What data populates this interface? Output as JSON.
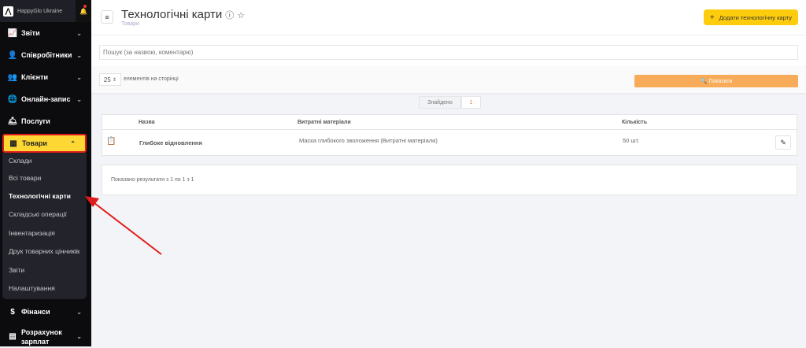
{
  "sidebar": {
    "brand": "HappyGlo Ukraine",
    "items": [
      {
        "label": "Звіти",
        "icon": "chart-icon"
      },
      {
        "label": "Співробітники",
        "icon": "user-icon"
      },
      {
        "label": "Клієнти",
        "icon": "users-icon"
      },
      {
        "label": "Онлайн-запис",
        "icon": "globe-icon"
      },
      {
        "label": "Послуги",
        "icon": "service-bell-icon"
      },
      {
        "label": "Товари",
        "icon": "boxes-icon"
      },
      {
        "label": "Фінанси",
        "icon": "dollar-icon"
      },
      {
        "label": "Розрахунок",
        "label2": "зарплат",
        "icon": "payroll-icon"
      }
    ],
    "submenu": [
      "Склади",
      "Всі товари",
      "Технологічні карти",
      "Складські операції",
      "Інвентаризація",
      "Друк товарних цінників",
      "Звіти",
      "Налаштування"
    ]
  },
  "header": {
    "title": "Технологічні карти",
    "breadcrumb": "Товари",
    "add_button": "Додати технологічну карту"
  },
  "search": {
    "placeholder": "Пошук (за назвою, коментарю)"
  },
  "filter": {
    "per_page": "25",
    "per_page_label": "елементів на сторінці",
    "show_button": "Показати"
  },
  "found": {
    "label": "Знайдено",
    "count": "1"
  },
  "table": {
    "headers": [
      "Назва",
      "Витратні матеріали",
      "Кількість"
    ],
    "rows": [
      {
        "name": "Глибоке відновлення",
        "materials": "Маска глибокого зволоження (Витратні матеріали)",
        "qty": "50 шт."
      }
    ]
  },
  "results": "Показано результати з 1 по 1 з 1",
  "colors": {
    "accent": "#fdcc0d",
    "show": "#f8ac59",
    "highlight": "#e01b1b"
  }
}
